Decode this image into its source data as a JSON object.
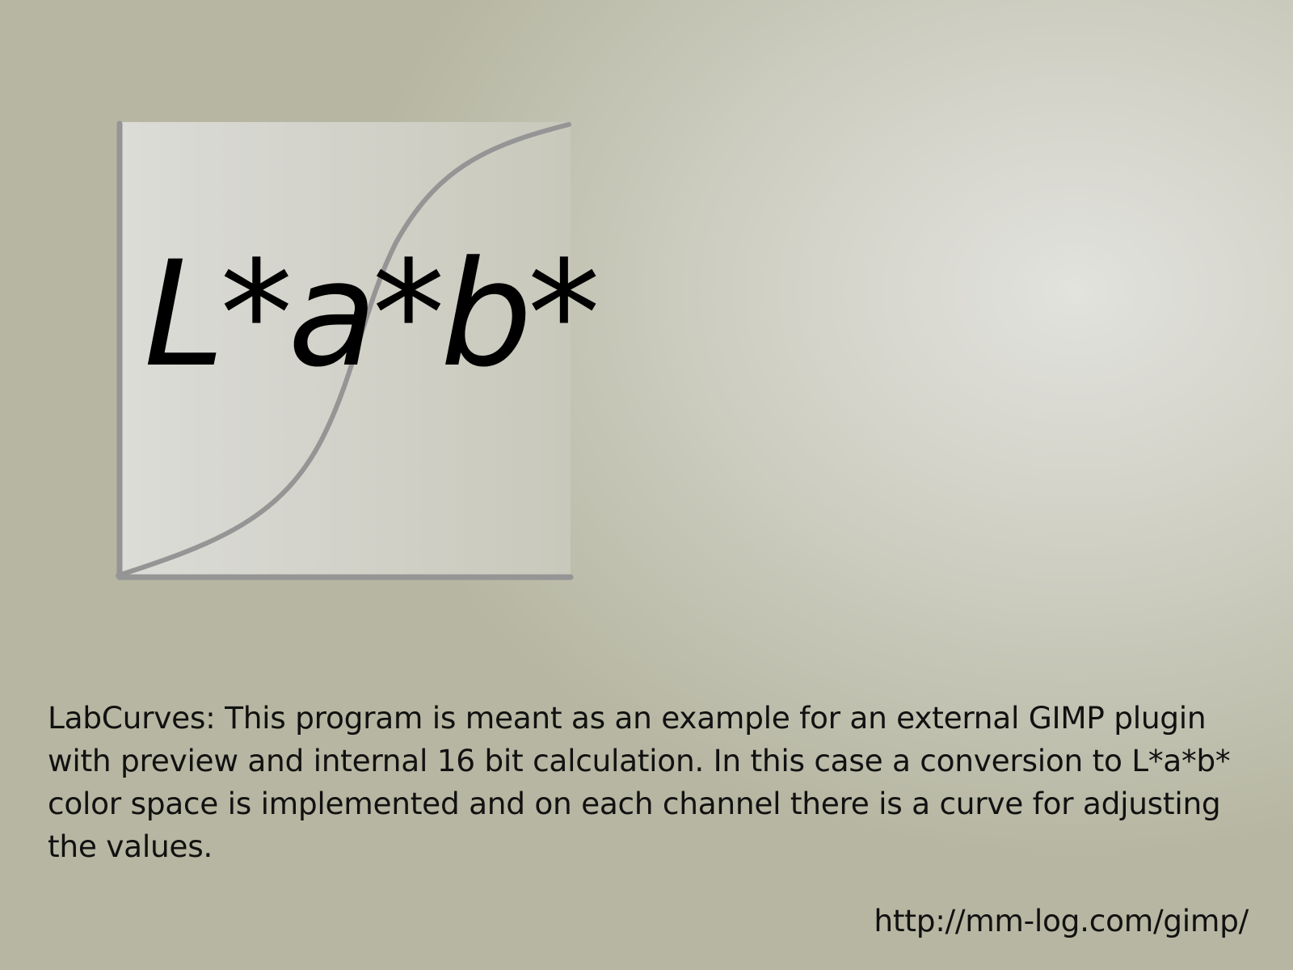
{
  "logo": {
    "title": "L*a*b*",
    "curve_color": "#959595",
    "axis_color": "#959595"
  },
  "description": {
    "text": "LabCurves: This program is meant as an example for an external GIMP plugin with preview and internal 16 bit calculation. In this case a conversion to L*a*b* color space is implemented and on each channel there is a curve for adjusting the values."
  },
  "footer": {
    "url": "http://mm-log.com/gimp/"
  }
}
